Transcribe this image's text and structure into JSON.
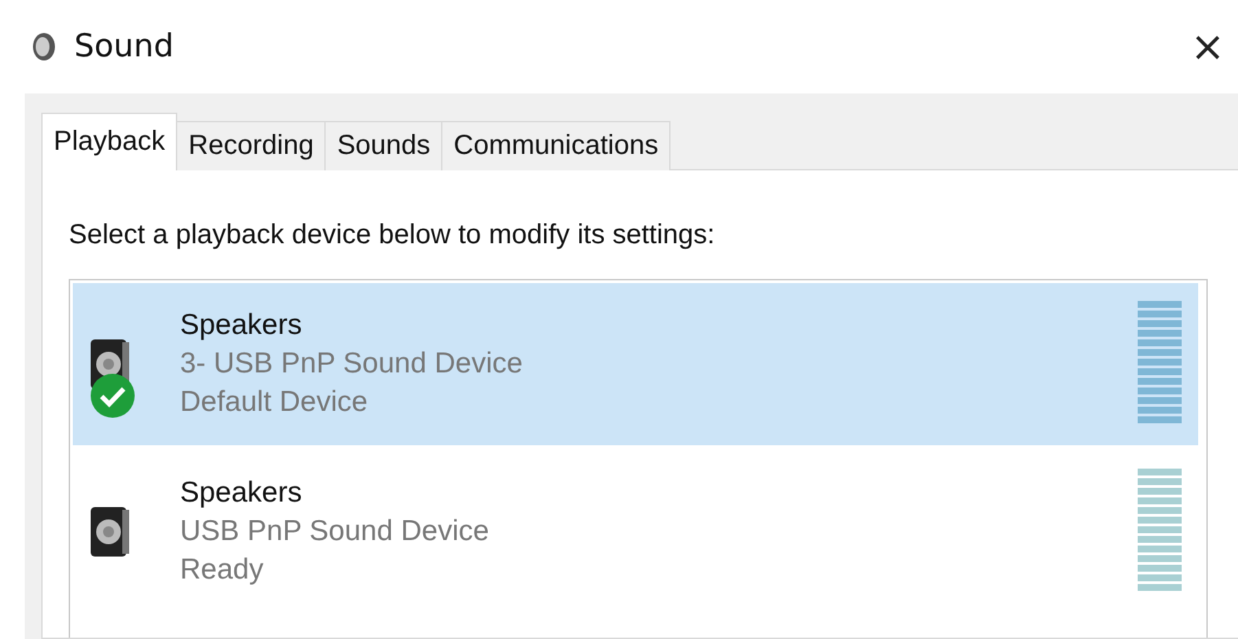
{
  "window": {
    "title": "Sound",
    "close": "×"
  },
  "tabs": [
    {
      "label": "Playback",
      "selected": true
    },
    {
      "label": "Recording",
      "selected": false
    },
    {
      "label": "Sounds",
      "selected": false
    },
    {
      "label": "Communications",
      "selected": false
    }
  ],
  "instruction": "Select a playback device below to modify its settings:",
  "devices": [
    {
      "name": "Speakers",
      "description": "3- USB PnP Sound Device",
      "status": "Default Device",
      "selected": true,
      "default": true
    },
    {
      "name": "Speakers",
      "description": "USB PnP Sound Device",
      "status": "Ready",
      "selected": false,
      "default": false
    }
  ]
}
